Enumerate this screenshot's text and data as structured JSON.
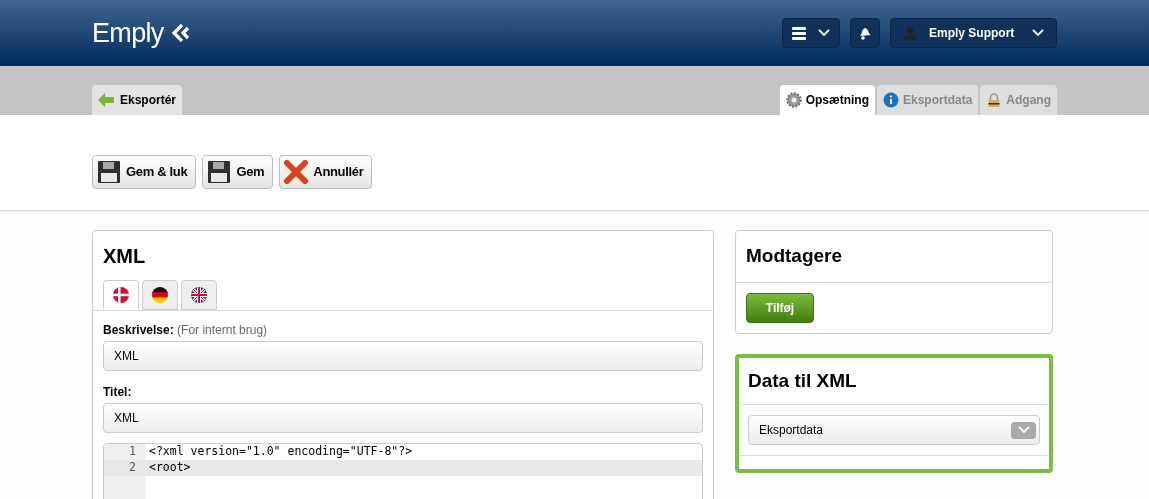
{
  "header": {
    "logo": "Emply",
    "user": "Emply Support"
  },
  "back_tab": {
    "label": "Eksportér"
  },
  "tabs": [
    {
      "label": "Opsætning",
      "kind": "gear",
      "selected": true
    },
    {
      "label": "Eksportdata",
      "kind": "info",
      "selected": false
    },
    {
      "label": "Adgang",
      "kind": "lock",
      "selected": false
    }
  ],
  "toolbar": [
    {
      "label": "Gem & luk",
      "kind": "save"
    },
    {
      "label": "Gem",
      "kind": "save"
    },
    {
      "label": "Annullér",
      "kind": "cancel"
    }
  ],
  "xml_panel": {
    "title": "XML",
    "language_tabs": [
      {
        "kind": "dk",
        "selected": true
      },
      {
        "kind": "de",
        "selected": false
      },
      {
        "kind": "gb",
        "selected": false
      }
    ],
    "description": {
      "label": "Beskrivelse:",
      "hint": "(For internt brug)",
      "value": "XML"
    },
    "title_field": {
      "label": "Titel:",
      "value": "XML"
    },
    "code_lines": [
      {
        "number": "1",
        "text": "<?xml version=\"1.0\" encoding=\"UTF-8\"?>",
        "active": false
      },
      {
        "number": "2",
        "text": "<root>",
        "active": true
      }
    ]
  },
  "recipients_panel": {
    "title": "Modtagere",
    "button": "Tilføj",
    "highlighted": false
  },
  "data_panel": {
    "title": "Data til XML",
    "select": "Eksportdata",
    "highlighted": true
  }
}
